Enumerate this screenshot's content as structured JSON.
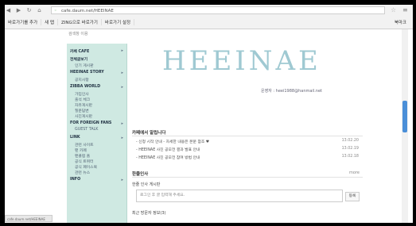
{
  "browser": {
    "url": "cafe.daum.net/HEEINAE",
    "bookmarks": [
      "바로가기를 추가",
      "새 탭",
      "ZING으로 바로가기",
      "바로가기 설정"
    ],
    "bookmark_right": "북마크"
  },
  "page": {
    "top_note": "검색창 이용",
    "logo": "HEEINAE",
    "logo_sub": "운영자 : heei1988@hanmail.net"
  },
  "sidebar": {
    "items": [
      {
        "label": "카페 CAFE",
        "type": "head"
      },
      {
        "label": "전체글보기",
        "type": "head"
      },
      {
        "label": "인기 게시판",
        "type": "sub"
      },
      {
        "label": "HEEINAE STORY",
        "type": "head"
      },
      {
        "label": "공지사항",
        "type": "sub"
      },
      {
        "label": "ZIBBA WORLD",
        "type": "head"
      },
      {
        "label": "가입인사",
        "type": "sub"
      },
      {
        "label": "출석 체크",
        "type": "sub"
      },
      {
        "label": "자유게시판",
        "type": "sub"
      },
      {
        "label": "질문답변",
        "type": "sub"
      },
      {
        "label": "사진게시판",
        "type": "sub"
      },
      {
        "label": "FOR FOREIGN FANS",
        "type": "head"
      },
      {
        "label": "GUEST TALK",
        "type": "sub"
      },
      {
        "label": "LINK",
        "type": "head"
      },
      {
        "label": "관련 사이트",
        "type": "sub"
      },
      {
        "label": "팬 카페",
        "type": "sub"
      },
      {
        "label": "팬클럽 홈",
        "type": "sub"
      },
      {
        "label": "공식 트위터",
        "type": "sub"
      },
      {
        "label": "공식 페이스북",
        "type": "sub"
      },
      {
        "label": "관련 뉴스",
        "type": "sub"
      },
      {
        "label": "INFO",
        "type": "head"
      }
    ]
  },
  "posts_section": {
    "title": "카페에서 알립니다",
    "rows": [
      {
        "title": "- 신청 시작 안내 - 자세한 내용은 본문 참조 ♥",
        "date": "13.02.20"
      },
      {
        "title": "- HEEINAE 사진 공모전 결과 발표 안내",
        "date": "13.02.19"
      },
      {
        "title": "- HEEINAE 사진 공모전 참여 방법 안내",
        "date": "13.02.18"
      }
    ]
  },
  "comment_section": {
    "title": "한줄인사",
    "more": "more",
    "notice": "한줄 인사 게시판",
    "placeholder": "로그인 후 글 입력해 주세요.",
    "button": "등록"
  },
  "footer_section": {
    "title": "최근 방문자 정보(3)"
  },
  "status": {
    "text": "cafe.daum.net/HEEINAE"
  }
}
